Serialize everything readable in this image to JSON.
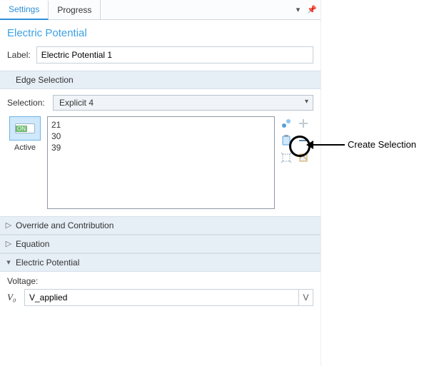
{
  "tabs": {
    "settings": "Settings",
    "progress": "Progress"
  },
  "title": "Electric Potential",
  "label_caption": "Label:",
  "label_value": "Electric Potential 1",
  "sections": {
    "edge": "Edge Selection",
    "override": "Override and Contribution",
    "equation": "Equation",
    "potential": "Electric Potential"
  },
  "selection": {
    "caption": "Selection:",
    "value": "Explicit 4",
    "items": [
      "21",
      "30",
      "39"
    ]
  },
  "toggle": {
    "on": "ON",
    "label": "Active"
  },
  "voltage": {
    "caption": "Voltage:",
    "symbol": "V₀",
    "value": "V_applied",
    "unit": "V"
  },
  "annotation": "Create Selection",
  "icons": {
    "create_selection": "create-selection-icon",
    "add": "add-icon",
    "paste": "paste-icon",
    "remove": "remove-icon",
    "zoom": "zoom-to-selection-icon",
    "clear": "clear-icon"
  },
  "colors": {
    "accent": "#3da0e3",
    "section_bg": "#e6eef6"
  }
}
